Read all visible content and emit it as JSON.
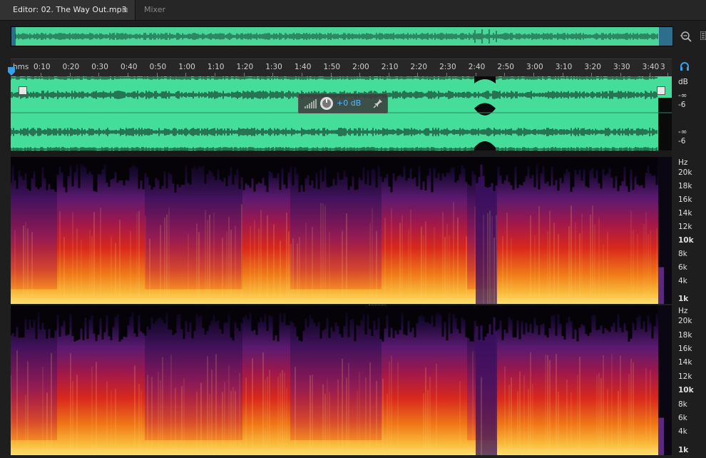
{
  "editor_tab": {
    "label": "Editor: 02. The Way Out.mp3",
    "menu_glyph": "≡"
  },
  "mixer_tab": {
    "label": "Mixer"
  },
  "icons": {
    "zoom": "zoom-icon",
    "panel": "panel-menu-icon",
    "headphone": "headphone-icon",
    "playhead": "playhead-marker-icon",
    "knob": "volume-knob-icon",
    "pin": "pin-icon"
  },
  "ruler": {
    "unit": "hms",
    "labels": [
      "0:10",
      "0:20",
      "0:30",
      "0:40",
      "0:50",
      "1:00",
      "1:10",
      "1:20",
      "1:30",
      "1:40",
      "1:50",
      "2:00",
      "2:10",
      "2:20",
      "2:30",
      "2:40",
      "2:50",
      "3:00",
      "3:10",
      "3:20",
      "3:30",
      "3:40",
      "3"
    ]
  },
  "hud": {
    "gain": "+0 dB"
  },
  "db_scale": {
    "ch1": [
      "dB",
      "-∞",
      "-6"
    ],
    "ch2": [
      "-∞",
      "-6"
    ]
  },
  "hz_scale": [
    "Hz",
    "20k",
    "18k",
    "16k",
    "14k",
    "12k",
    "10k",
    "8k",
    "6k",
    "4k",
    "1k"
  ],
  "colors": {
    "waveform_fill": "#44dd99",
    "waveform_line": "#0a0a0a",
    "accent": "#3aa0e8",
    "spectrum_hot": "#ffd060",
    "spectrum_cold": "#2a0a40"
  }
}
